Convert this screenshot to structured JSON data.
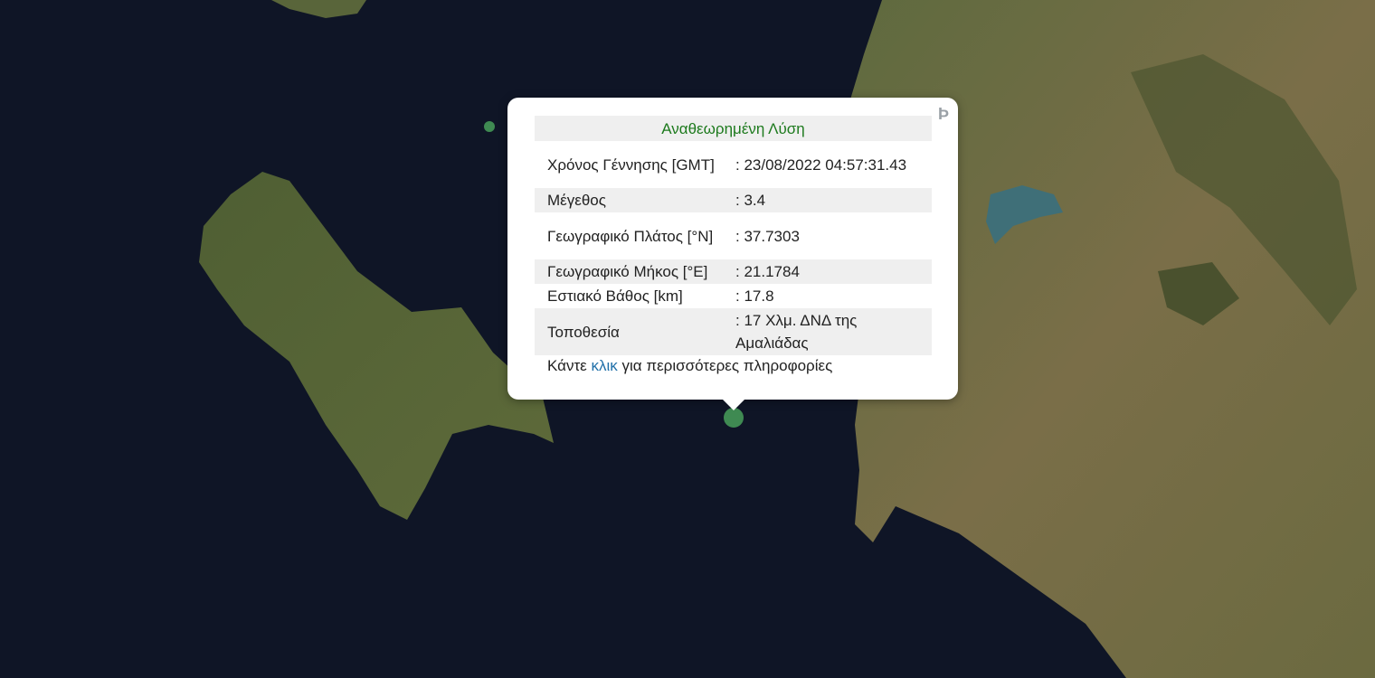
{
  "popup": {
    "title": "Αναθεωρημένη Λύση",
    "rows": [
      {
        "label": "Χρόνος Γέννησης [GMT]",
        "value": ": 23/08/2022 04:57:31.43"
      },
      {
        "label": "Μέγεθος",
        "value": ": 3.4"
      },
      {
        "label": "Γεωγραφικό Πλάτος [°N]",
        "value": ": 37.7303"
      },
      {
        "label": "Γεωγραφικό Μήκος [°E]",
        "value": ": 21.1784"
      },
      {
        "label": "Εστιακό Βάθος [km]",
        "value": ": 17.8"
      },
      {
        "label": "Τοποθεσία",
        "value": ": 17 Χλμ. ΔΝΔ της Αμαλιάδας"
      }
    ],
    "footer_prefix": "Κάντε",
    "footer_link": "κλικ",
    "footer_suffix": "για περισσότερες πληροφορίες",
    "brand_icon": "b-logo-icon"
  },
  "colors": {
    "sea": "#0f1526",
    "marker": "#3f8a52",
    "title": "#1d7a1d",
    "link": "#1f6fa8"
  }
}
